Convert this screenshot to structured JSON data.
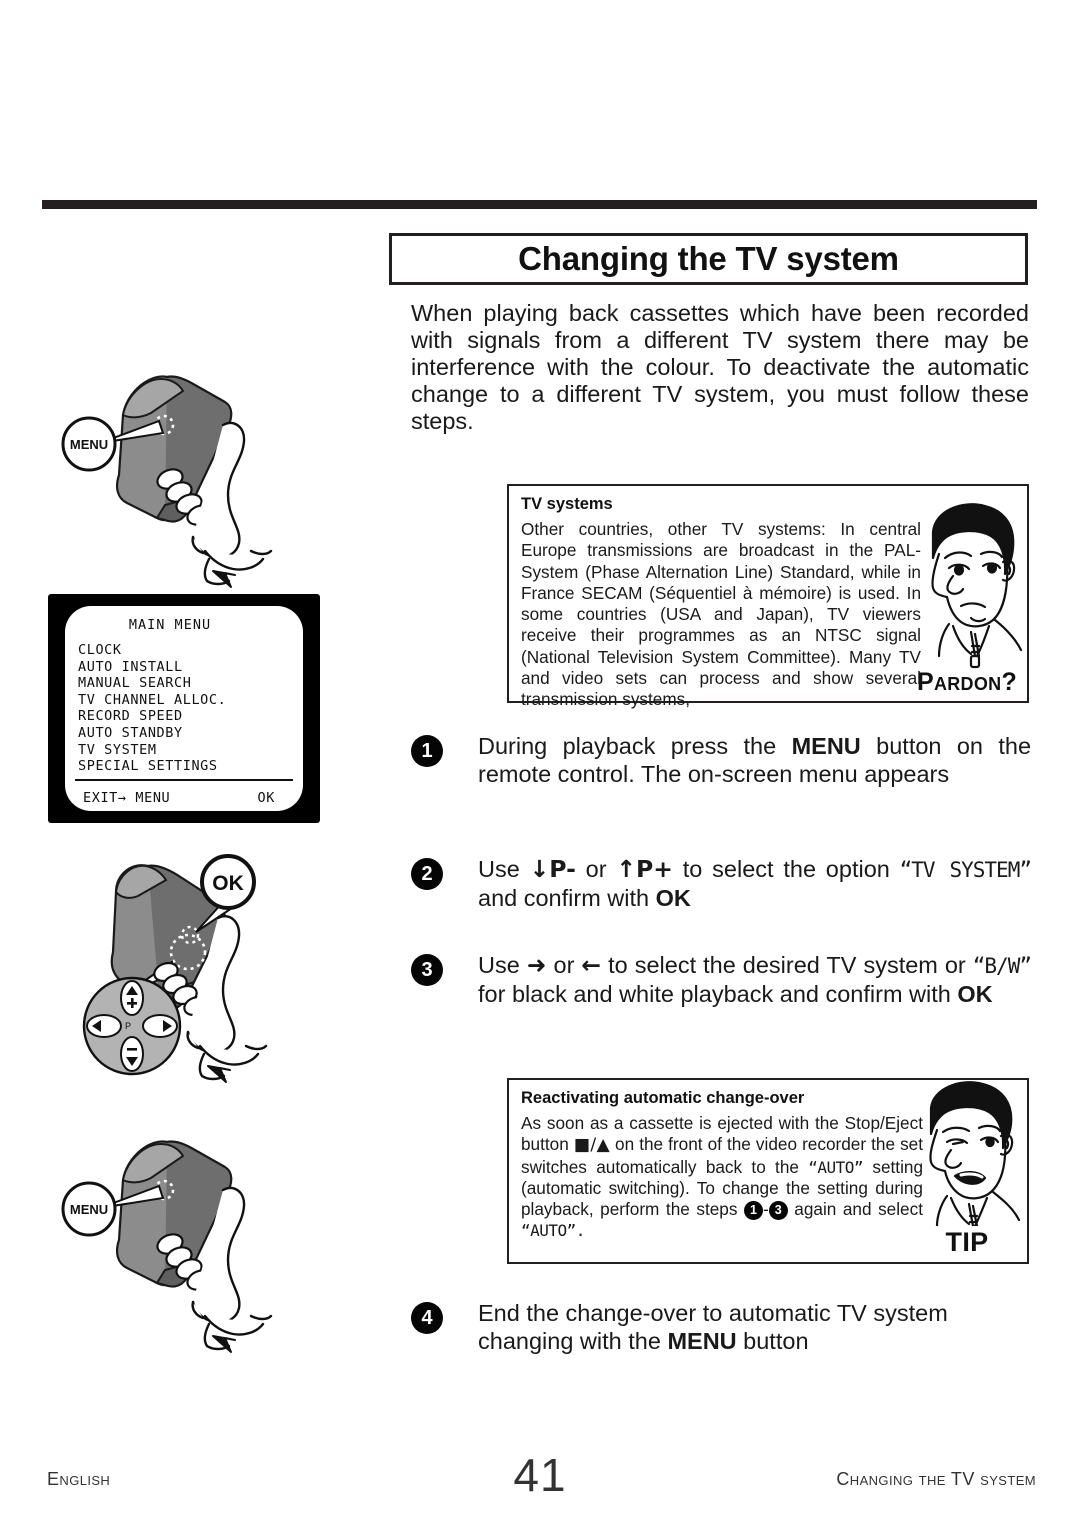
{
  "title": "Changing the TV system",
  "intro": "When playing back cassettes which have been recorded with signals from a different TV system there may be interference with the colour. To deactivate the automatic change to a different TV system, you must follow these steps.",
  "info_box_tv_systems": {
    "heading": "TV systems",
    "body": "Other countries, other TV systems: In central Europe transmissions are broadcast in the PAL-System (Phase Alternation Line) Standard, while in France SECAM (Séquentiel à mémoire) is used. In some countries (USA and Japan), TV viewers receive their programmes as an NTSC signal (National Television System Committee). Many TV and video sets can process and show several transmission systems,",
    "character_label": "Pardon?"
  },
  "info_box_tip": {
    "heading": "Reactivating automatic change-over",
    "body_part1": "As soon as a cassette is ejected with the Stop/Eject button",
    "stop_eject_symbol": "■/▲",
    "body_part2": "on the front of the video recorder the set switches automatically back to the",
    "auto_value_1": "“AUTO”",
    "body_part3": "setting (automatic switching). To change the setting during playback, perform the steps",
    "step_ref_from": "1",
    "step_ref_dash": "-",
    "step_ref_to": "3",
    "body_part4": "again and select",
    "auto_value_2": "“AUTO”.",
    "character_label": "TIP"
  },
  "steps": [
    {
      "number": "1",
      "text_a": "During playback press the",
      "emph_1": "MENU",
      "text_b": "button on the remote control. The on-screen menu appears"
    },
    {
      "number": "2",
      "text_a": "Use",
      "key_down": "↓P-",
      "text_or": "or",
      "key_up": "↑P+",
      "text_b": "to select the option",
      "option": "“TV SYSTEM”",
      "text_c": "and confirm with",
      "emph_1": "OK"
    },
    {
      "number": "3",
      "text_a": "Use",
      "key_right": "➜",
      "text_or": "or",
      "key_left": "←",
      "text_b": "to select the desired TV system or",
      "option": "“B/W”",
      "text_c": "for black and white playback and confirm with",
      "emph_1": "OK"
    },
    {
      "number": "4",
      "text_a": "End the change-over to automatic TV system changing with the",
      "emph_1": "MENU",
      "text_b": "button"
    }
  ],
  "osd_screen": {
    "title": "MAIN MENU",
    "items": [
      "CLOCK",
      "AUTO INSTALL",
      "MANUAL SEARCH",
      "TV CHANNEL ALLOC.",
      "RECORD SPEED",
      "AUTO STANDBY",
      "TV SYSTEM",
      "SPECIAL SETTINGS"
    ],
    "footer_left": "EXIT→ MENU",
    "footer_right": "OK"
  },
  "illustrations": {
    "remote_menu_top_callout": "MENU",
    "remote_ok_callout": "OK",
    "remote_menu_bottom_callout": "MENU"
  },
  "footer": {
    "left": "English",
    "page": "41",
    "right": "Changing the TV system"
  },
  "colors": {
    "ink": "#231f20",
    "remote_body": "#8c8c8c",
    "remote_shade": "#6e6e6e",
    "remote_light": "#a6a6a6",
    "pad_gray": "#b3b3b3"
  }
}
